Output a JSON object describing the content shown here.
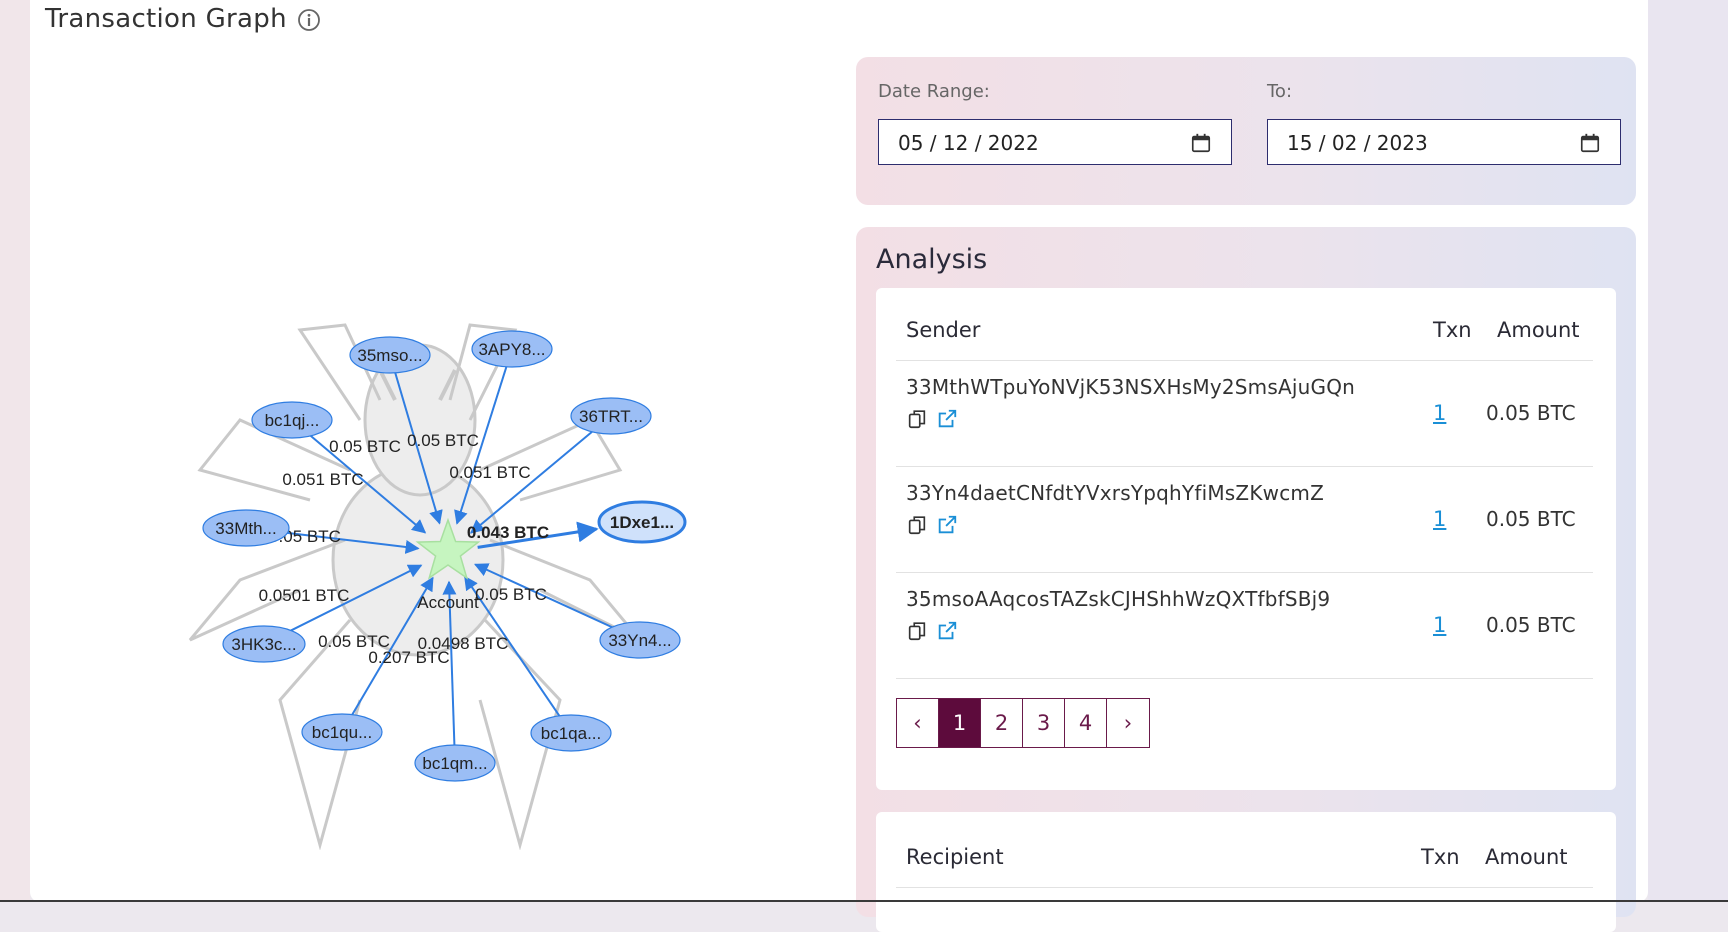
{
  "header": {
    "title": "Transaction Graph",
    "info_icon": "info-circle-icon"
  },
  "graph": {
    "center_label": "Account",
    "nodes": [
      {
        "label": "35mso...",
        "edge": "0.05 BTC"
      },
      {
        "label": "3APY8...",
        "edge": "0.05 BTC"
      },
      {
        "label": "bc1qj...",
        "edge": "0.051 BTC"
      },
      {
        "label": "36TRT...",
        "edge": "0.051 BTC"
      },
      {
        "label": "33Mth...",
        "edge": "0.05 BTC"
      },
      {
        "label": "1Dxe1...",
        "edge": "0.043 BTC"
      },
      {
        "label": "3HK3c...",
        "edge": "0.0501 BTC"
      },
      {
        "label": "33Yn4...",
        "edge": "0.05 BTC"
      },
      {
        "label": "bc1qu...",
        "edge": "0.05 BTC"
      },
      {
        "label": "bc1qm...",
        "edge": "0.207 BTC"
      },
      {
        "label": "bc1qa...",
        "edge": "0.0498 BTC"
      }
    ],
    "colors": {
      "node_fill": "#9bbef5",
      "node_stroke": "#2f7de1",
      "edge": "#2f7de1",
      "center": "#c6f5c0"
    }
  },
  "date_range": {
    "from_label": "Date Range:",
    "from_value": "05 / 12 / 2022",
    "to_label": "To:",
    "to_value": "15 / 02 / 2023"
  },
  "analysis": {
    "title": "Analysis",
    "sender": {
      "headers": {
        "address": "Sender",
        "txn": "Txn",
        "amount": "Amount"
      },
      "rows": [
        {
          "address": "33MthWTpuYoNVjK53NSXHsMy2SmsAjuGQn",
          "txn": "1",
          "amount": "0.05 BTC"
        },
        {
          "address": "33Yn4daetCNfdtYVxrsYpqhYfiMsZKwcmZ",
          "txn": "1",
          "amount": "0.05 BTC"
        },
        {
          "address": "35msoAAqcosTAZskCJHShhWzQXTfbfSBj9",
          "txn": "1",
          "amount": "0.05 BTC"
        }
      ],
      "pagination": {
        "prev": "‹",
        "pages": [
          "1",
          "2",
          "3",
          "4"
        ],
        "next": "›",
        "current": 1
      }
    },
    "recipient": {
      "headers": {
        "address": "Recipient",
        "txn": "Txn",
        "amount": "Amount"
      }
    }
  }
}
